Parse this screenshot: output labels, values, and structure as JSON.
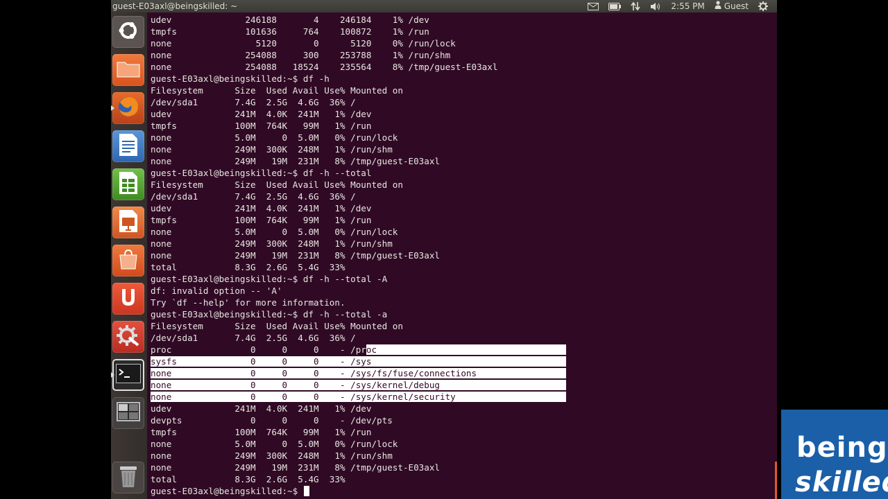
{
  "panel": {
    "window_title": "guest-E03axl@beingskilled: ~",
    "time": "2:55 PM",
    "user": "Guest"
  },
  "launcher": {
    "items": [
      {
        "name": "Dash Home",
        "icon": "ubuntu-logo-icon",
        "color": "#5a5350"
      },
      {
        "name": "Files",
        "icon": "folder-icon",
        "color": "#e0622a"
      },
      {
        "name": "Firefox",
        "icon": "firefox-icon",
        "color": "#d9531e"
      },
      {
        "name": "LibreOffice Writer",
        "icon": "writer-icon",
        "color": "#3b79c4"
      },
      {
        "name": "LibreOffice Calc",
        "icon": "calc-icon",
        "color": "#4a9a2e"
      },
      {
        "name": "LibreOffice Impress",
        "icon": "impress-icon",
        "color": "#e3622a"
      },
      {
        "name": "Software Center",
        "icon": "shopping-bag-icon",
        "color": "#e0622a"
      },
      {
        "name": "Ubuntu One",
        "icon": "ubuntu-one-icon",
        "color": "#e0422a"
      },
      {
        "name": "System Settings",
        "icon": "settings-icon",
        "color": "#d33c2a"
      },
      {
        "name": "Terminal",
        "icon": "terminal-icon",
        "color": "#2a2a2a"
      },
      {
        "name": "Workspace Switcher",
        "icon": "workspace-icon",
        "color": "#444040"
      },
      {
        "name": "Trash",
        "icon": "trash-icon",
        "color": "#4a4442"
      }
    ]
  },
  "terminal": {
    "lines": [
      "udev              246188       4    246184    1% /dev",
      "tmpfs             101636     764    100872    1% /run",
      "none                5120       0      5120    0% /run/lock",
      "none              254088     300    253788    1% /run/shm",
      "none              254088   18524    235564    8% /tmp/guest-E03axl",
      "guest-E03axl@beingskilled:~$ df -h",
      "Filesystem      Size  Used Avail Use% Mounted on",
      "/dev/sda1       7.4G  2.5G  4.6G  36% /",
      "udev            241M  4.0K  241M   1% /dev",
      "tmpfs           100M  764K   99M   1% /run",
      "none            5.0M     0  5.0M   0% /run/lock",
      "none            249M  300K  248M   1% /run/shm",
      "none            249M   19M  231M   8% /tmp/guest-E03axl",
      "guest-E03axl@beingskilled:~$ df -h --total",
      "Filesystem      Size  Used Avail Use% Mounted on",
      "/dev/sda1       7.4G  2.5G  4.6G  36% /",
      "udev            241M  4.0K  241M   1% /dev",
      "tmpfs           100M  764K   99M   1% /run",
      "none            5.0M     0  5.0M   0% /run/lock",
      "none            249M  300K  248M   1% /run/shm",
      "none            249M   19M  231M   8% /tmp/guest-E03axl",
      "total           8.3G  2.6G  5.4G  33%",
      "guest-E03axl@beingskilled:~$ df -h --total -A",
      "df: invalid option -- 'A'",
      "Try `df --help' for more information.",
      "guest-E03axl@beingskilled:~$ df -h --total -a",
      "Filesystem      Size  Used Avail Use% Mounted on",
      "/dev/sda1       7.4G  2.5G  4.6G  36% /",
      "proc               0     0     0    - /proc",
      "sysfs              0     0     0    - /sys",
      "none               0     0     0    - /sys/fs/fuse/connections",
      "none               0     0     0    - /sys/kernel/debug",
      "none               0     0     0    - /sys/kernel/security",
      "udev            241M  4.0K  241M   1% /dev",
      "devpts             0     0     0    - /dev/pts",
      "tmpfs           100M  764K   99M   1% /run",
      "none            5.0M     0  5.0M   0% /run/lock",
      "none            249M  300K  248M   1% /run/shm",
      "none            249M   19M  231M   8% /tmp/guest-E03axl",
      "total           8.3G  2.6G  5.4G  33%",
      "guest-E03axl@beingskilled:~$ "
    ]
  },
  "logo": {
    "line1": "being",
    "line2": "skilled"
  },
  "colors": {
    "terminal_bg": "#300a24",
    "terminal_fg": "#e8e6e3",
    "selection_bg": "#ffffff",
    "logo_bg": "#1a5fa8"
  }
}
